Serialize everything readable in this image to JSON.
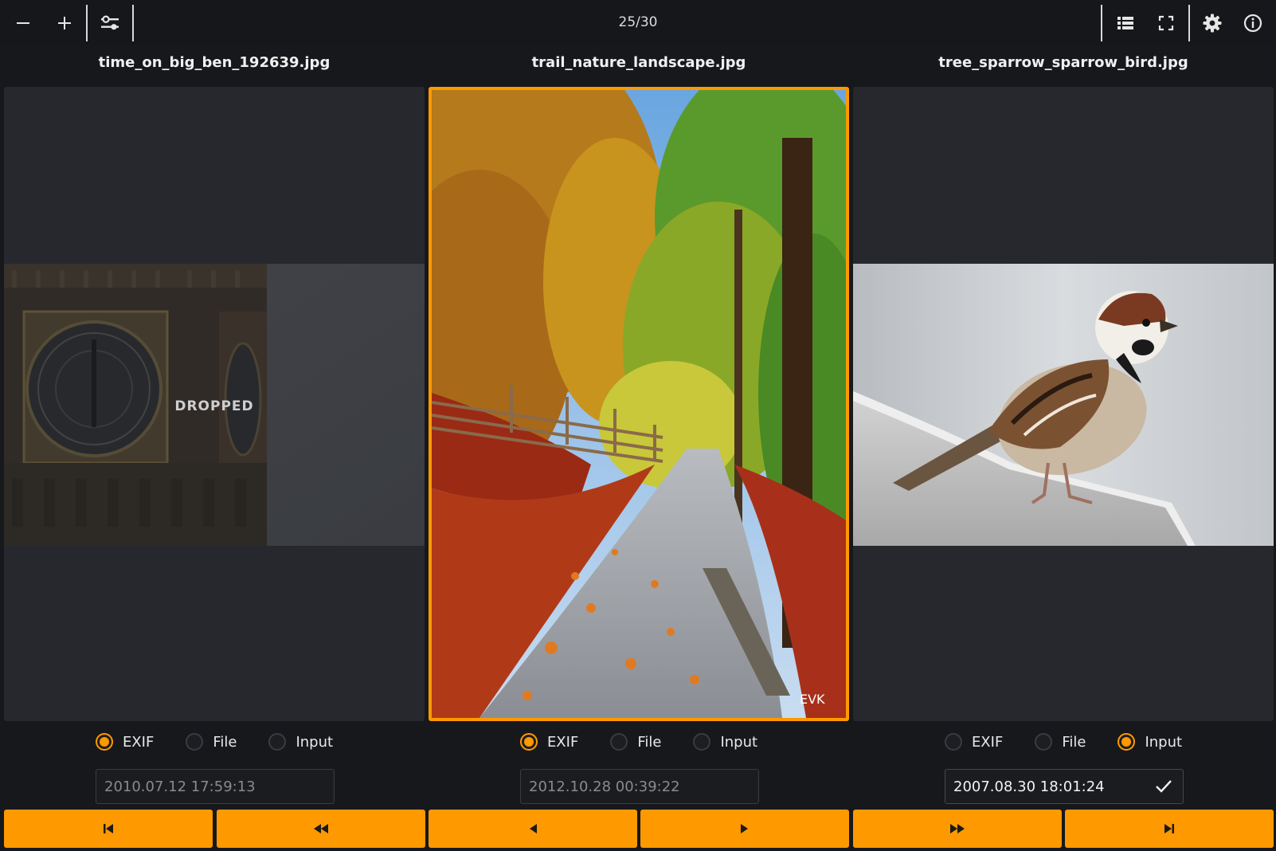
{
  "toolbar": {
    "counter": "25/30",
    "left_icons": [
      "minus-icon",
      "plus-icon",
      "sliders-icon"
    ],
    "right_icons": [
      "list-icon",
      "fullscreen-icon",
      "gear-icon",
      "info-icon"
    ]
  },
  "columns": [
    {
      "filename": "time_on_big_ben_192639.jpg",
      "overlay_label": "DROPPED",
      "radio_options": [
        "EXIF",
        "File",
        "Input"
      ],
      "selected_radio": "EXIF",
      "date_value": "2010.07.12 17:59:13"
    },
    {
      "filename": "trail_nature_landscape.jpg",
      "watermark": "EVK",
      "radio_options": [
        "EXIF",
        "File",
        "Input"
      ],
      "selected_radio": "EXIF",
      "date_value": "2012.10.28 00:39:22"
    },
    {
      "filename": "tree_sparrow_sparrow_bird.jpg",
      "radio_options": [
        "EXIF",
        "File",
        "Input"
      ],
      "selected_radio": "Input",
      "date_value": "2007.08.30 18:01:24"
    }
  ],
  "nav_buttons": [
    "skip-first-icon",
    "rewind-icon",
    "prev-icon",
    "next-icon",
    "fast-forward-icon",
    "skip-last-icon"
  ],
  "colors": {
    "accent": "#ff9900",
    "background": "#17181c",
    "panel": "#27282e"
  }
}
